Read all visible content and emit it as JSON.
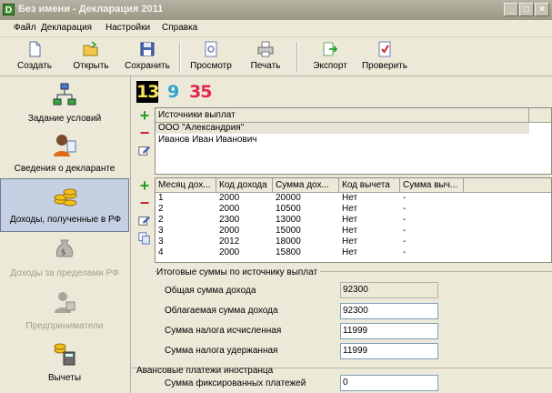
{
  "window": {
    "title": "Без имени - Декларация 2011"
  },
  "menu": [
    "Файл",
    "Декларация",
    "Настройки",
    "Справка"
  ],
  "toolbar": {
    "create": "Создать",
    "open": "Открыть",
    "save": "Сохранить",
    "preview": "Просмотр",
    "print": "Печать",
    "export": "Экспорт",
    "check": "Проверить"
  },
  "sidebar": {
    "items": [
      {
        "label": "Задание условий"
      },
      {
        "label": "Сведения о декларанте"
      },
      {
        "label": "Доходы, полученные в РФ"
      },
      {
        "label": "Доходы за пределами РФ"
      },
      {
        "label": "Предприниматели"
      },
      {
        "label": "Вычеты"
      }
    ]
  },
  "rates": {
    "r13": "13",
    "r9": "9",
    "r35": "35"
  },
  "sources": {
    "header": "Источники выплат",
    "rows": [
      "ООО \"Александрия\"",
      "Иванов Иван Иванович"
    ]
  },
  "income": {
    "headers": [
      "Месяц дох...",
      "Код дохода",
      "Сумма дох...",
      "Код вычета",
      "Сумма выч..."
    ],
    "rows": [
      [
        "1",
        "2000",
        "20000",
        "Нет",
        "-"
      ],
      [
        "2",
        "2000",
        "10500",
        "Нет",
        "-"
      ],
      [
        "2",
        "2300",
        "13000",
        "Нет",
        "-"
      ],
      [
        "3",
        "2000",
        "15000",
        "Нет",
        "-"
      ],
      [
        "3",
        "2012",
        "18000",
        "Нет",
        "-"
      ],
      [
        "4",
        "2000",
        "15800",
        "Нет",
        "-"
      ]
    ]
  },
  "totals": {
    "title": "Итоговые суммы по источнику выплат",
    "total_income_label": "Общая сумма дохода",
    "total_income": "92300",
    "taxable_label": "Облагаемая сумма дохода",
    "taxable": "92300",
    "tax_calc_label": "Сумма налога исчисленная",
    "tax_calc": "11999",
    "tax_withheld_label": "Сумма налога удержанная",
    "tax_withheld": "11999"
  },
  "advance": {
    "title": "Авансовые платежи иностранца",
    "fixed_label": "Сумма фиксированных платежей",
    "fixed": "0"
  }
}
